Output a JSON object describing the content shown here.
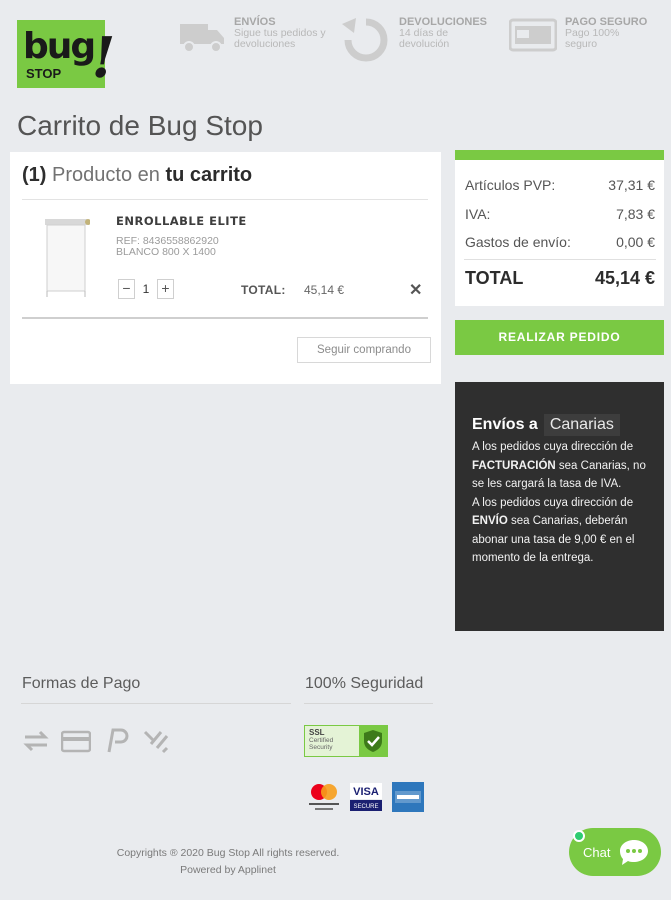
{
  "header": {
    "logo": {
      "line1": "bug",
      "line2": "STOP",
      "mark": "!"
    },
    "features": [
      {
        "icon": "truck-icon",
        "title": "ENVÍOS",
        "subtitle": "Sigue tus pedidos y devoluciones"
      },
      {
        "icon": "return-icon",
        "title": "DEVOLUCIONES",
        "subtitle": "14 días de devolución"
      },
      {
        "icon": "card-icon",
        "title": "PAGO SEGURO",
        "subtitle": "Pago 100% seguro"
      }
    ]
  },
  "page_title": "Carrito de Bug Stop",
  "cart": {
    "count": "(1)",
    "heading_a": "Producto",
    "heading_b": "en",
    "heading_c": "tu carrito",
    "item": {
      "name": "ENROLLABLE ELITE",
      "ref": "REF: 8436558862920",
      "variant": "BLANCO 800 X 1400",
      "qty": "1",
      "total_label": "TOTAL:",
      "total_value": "45,14 €"
    },
    "continue_label": "Seguir comprando"
  },
  "summary": {
    "pvp_label": "Artículos PVP:",
    "pvp_value": "37,31 €",
    "iva_label": "IVA:",
    "iva_value": "7,83 €",
    "envio_label": "Gastos de envío:",
    "envio_value": "0,00 €",
    "total_label": "TOTAL",
    "total_value": "45,14 €",
    "order_button": "REALIZAR PEDIDO"
  },
  "canarias": {
    "title": "Envíos a",
    "region": "Canarias",
    "p1_a": "A los pedidos cuya dirección de ",
    "p1_b": "FACTURACIÓN",
    "p1_c": " sea Canarias, no se les cargará la tasa de IVA.",
    "p2_a": "A los pedidos cuya dirección de ",
    "p2_b": "ENVÍO",
    "p2_c": " sea Canarias, deberán abonar una tasa de 9,00 € en el momento de la entrega."
  },
  "footer": {
    "payments_title": "Formas de Pago",
    "security_title": "100% Seguridad",
    "ssl_badge": {
      "line1": "SSL",
      "line2": "Certified",
      "line3": "Security"
    },
    "copyright": "Copyrights ® 2020 Bug Stop All rights reserved.",
    "powered": "Powered by Applinet",
    "cards": {
      "mc_text": "mastercard. ID Check",
      "visa": "VISA",
      "visa_sub": "SECURE",
      "amex": "AMERICAN EXPRESS"
    }
  },
  "chat": {
    "label": "Chat"
  },
  "colors": {
    "brand_green": "#7ac943",
    "dark_box": "#2f2f2f",
    "background": "#e9ebee"
  }
}
